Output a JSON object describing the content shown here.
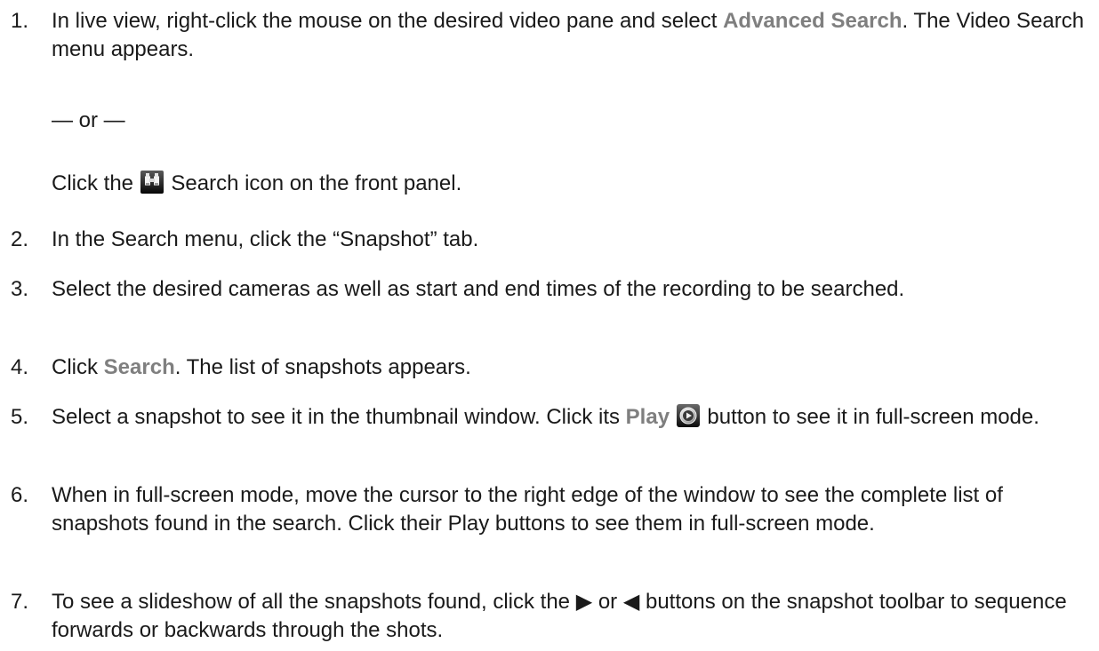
{
  "steps": [
    {
      "num": "1.",
      "t1": "In live view, right-click the mouse on the desired video pane and select ",
      "k1": "Advanced Search",
      "t2": ". The Video Search menu appears."
    },
    {
      "num": "2.",
      "text": "In the Search menu, click the “Snapshot” tab."
    },
    {
      "num": "3.",
      "text": "Select the desired cameras as well as start and end times of the recording to be searched."
    },
    {
      "num": "4.",
      "pre": "Click ",
      "kw": "Search",
      "post": ". The list of snapshots appears."
    },
    {
      "num": "5.",
      "pre": "Select a snapshot to see it in the thumbnail window. Click its ",
      "kw": "Play",
      "post": " button to see it in full-screen mode."
    },
    {
      "num": "6.",
      "text": "When in full-screen mode, move the cursor to the right edge of the window to see the complete list of snapshots found in the search. Click their Play buttons to see them in full-screen mode."
    },
    {
      "num": "7.",
      "pre": "To see a slideshow of all the snapshots found, click the ",
      "fwd": "▶",
      "or": " or ",
      "back": "◀",
      "post": " buttons on the snapshot toolbar to sequence forwards or backwards through the shots."
    }
  ],
  "or_line": "— or —",
  "alt": {
    "pre": "Click the ",
    "post": " Search icon on the front panel."
  },
  "icons": {
    "search": "binoculars-icon",
    "play": "play-button-icon"
  }
}
